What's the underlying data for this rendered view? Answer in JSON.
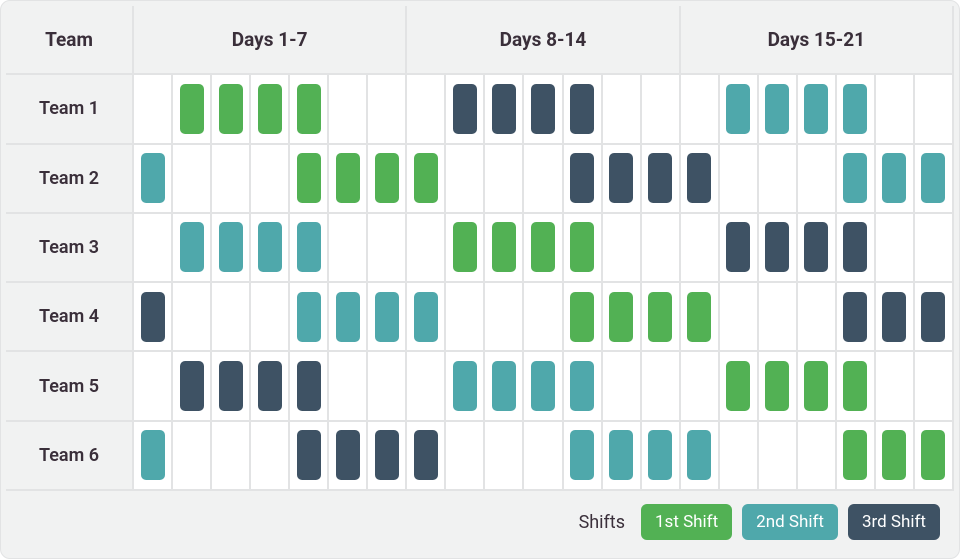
{
  "header": {
    "team_label": "Team",
    "periods": [
      "Days 1-7",
      "Days 8-14",
      "Days 15-21"
    ]
  },
  "legend": {
    "title": "Shifts",
    "items": [
      {
        "key": "s1",
        "label": "1st Shift",
        "color": "#52b154"
      },
      {
        "key": "s2",
        "label": "2nd Shift",
        "color": "#4fa8ab"
      },
      {
        "key": "s3",
        "label": "3rd Shift",
        "color": "#3e5264"
      }
    ]
  },
  "teams": [
    {
      "name": "Team 1"
    },
    {
      "name": "Team 2"
    },
    {
      "name": "Team 3"
    },
    {
      "name": "Team 4"
    },
    {
      "name": "Team 5"
    },
    {
      "name": "Team 6"
    }
  ],
  "chart_data": {
    "type": "table",
    "title": "Shift rotation schedule",
    "xlabel": "Day",
    "ylabel": "Team",
    "days_per_period": 7,
    "periods": 3,
    "shift_codes": {
      "0": "Off",
      "1": "1st Shift",
      "2": "2nd Shift",
      "3": "3rd Shift"
    },
    "schedule": [
      {
        "team": "Team 1",
        "days": [
          0,
          1,
          1,
          1,
          1,
          0,
          0,
          0,
          3,
          3,
          3,
          3,
          0,
          0,
          0,
          2,
          2,
          2,
          2,
          0,
          0
        ]
      },
      {
        "team": "Team 2",
        "days": [
          2,
          0,
          0,
          0,
          1,
          1,
          1,
          1,
          0,
          0,
          0,
          3,
          3,
          3,
          3,
          0,
          0,
          0,
          2,
          2,
          2
        ]
      },
      {
        "team": "Team 3",
        "days": [
          0,
          2,
          2,
          2,
          2,
          0,
          0,
          0,
          1,
          1,
          1,
          1,
          0,
          0,
          0,
          3,
          3,
          3,
          3,
          0,
          0
        ]
      },
      {
        "team": "Team 4",
        "days": [
          3,
          0,
          0,
          0,
          2,
          2,
          2,
          2,
          0,
          0,
          0,
          1,
          1,
          1,
          1,
          0,
          0,
          0,
          3,
          3,
          3
        ]
      },
      {
        "team": "Team 5",
        "days": [
          0,
          3,
          3,
          3,
          3,
          0,
          0,
          0,
          2,
          2,
          2,
          2,
          0,
          0,
          0,
          1,
          1,
          1,
          1,
          0,
          0
        ]
      },
      {
        "team": "Team 6",
        "days": [
          2,
          0,
          0,
          0,
          3,
          3,
          3,
          3,
          0,
          0,
          0,
          2,
          2,
          2,
          2,
          0,
          0,
          0,
          1,
          1,
          1
        ]
      }
    ]
  }
}
